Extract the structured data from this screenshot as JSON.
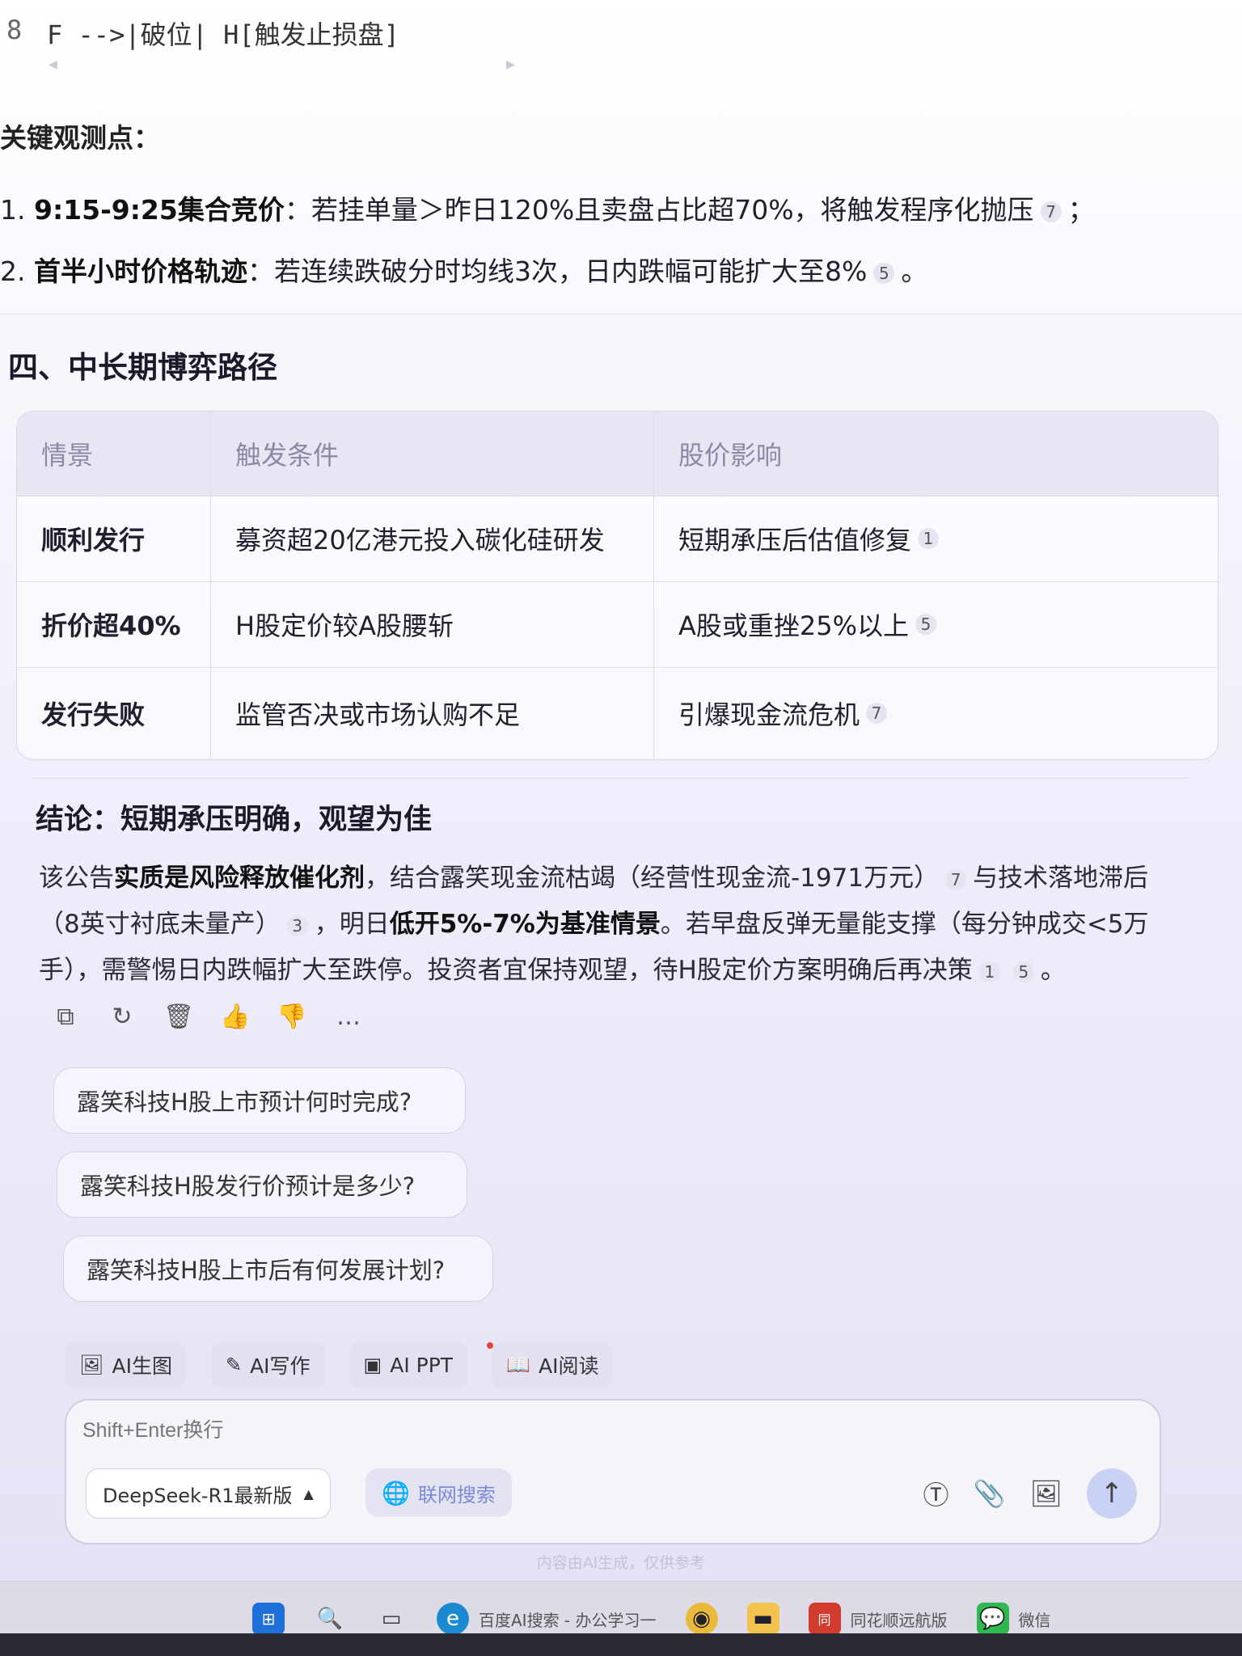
{
  "code": {
    "line_number": "8",
    "text": "F -->|破位| H[触发止损盘]"
  },
  "key_points": {
    "heading": "关键观测点：",
    "items": [
      {
        "num": "1.",
        "bold": "9:15-9:25集合竞价",
        "text": "：若挂单量＞昨日120%且卖盘占比超70%，将触发程序化抛压",
        "cite": "7",
        "tail": "；"
      },
      {
        "num": "2.",
        "bold": "首半小时价格轨迹",
        "text": "：若连续跌破分时均线3次，日内跌幅可能扩大至8%",
        "cite": "5",
        "tail": "。"
      }
    ]
  },
  "section4": {
    "title": "四、中长期博弈路径"
  },
  "table": {
    "headers": [
      "情景",
      "触发条件",
      "股价影响"
    ],
    "rows": [
      {
        "scenario": "顺利发行",
        "condition": "募资超20亿港元投入碳化硅研发",
        "impact": "短期承压后估值修复",
        "cite": "1"
      },
      {
        "scenario": "折价超40%",
        "condition": "H股定价较A股腰斩",
        "impact": "A股或重挫25%以上",
        "cite": "5"
      },
      {
        "scenario": "发行失败",
        "condition": "监管否决或市场认购不足",
        "impact": "引爆现金流危机",
        "cite": "7"
      }
    ]
  },
  "conclusion": {
    "title": "结论：短期承压明确，观望为佳",
    "p1": "该公告",
    "p1_bold": "实质是风险释放催化剂",
    "p2": "，结合露笑现金流枯竭（经营性现金流-1971万元）",
    "c1": "7",
    "p3": "与技术落地滞后（8英寸衬底未量产）",
    "c2": "3",
    "p4": "，明日",
    "p4_bold": "低开5%-7%为基准情景",
    "p5": "。若早盘反弹无量能支撑（每分钟成交<5万手），需警惕日内跌幅扩大至跌停。投资者宜保持观望，待H股定价方案明确后再决策",
    "c3": "1",
    "c4": "5",
    "p6": "。"
  },
  "suggestions": [
    "露笑科技H股上市预计何时完成?",
    "露笑科技H股发行价预计是多少?",
    "露笑科技H股上市后有何发展计划?"
  ],
  "tools": [
    "AI生图",
    "AI写作",
    "AI PPT",
    "AI阅读"
  ],
  "input": {
    "placeholder": "Shift+Enter换行",
    "model": "DeepSeek-R1最新版",
    "web_search": "联网搜索"
  },
  "disclaimer": "内容由AI生成，仅供参考",
  "taskbar": {
    "edge_label": "百度AI搜索 - 办公学习一",
    "ths_label": "同花顺远航版",
    "wechat_label": "微信"
  }
}
